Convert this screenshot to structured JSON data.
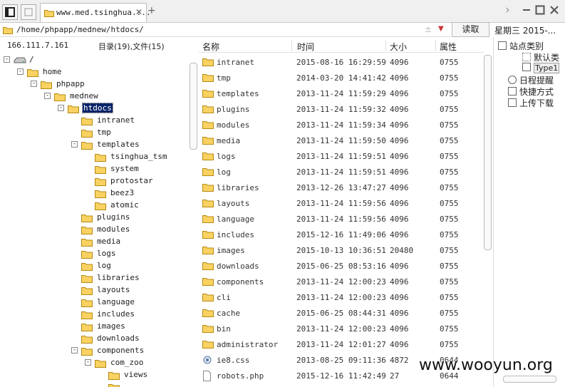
{
  "tab": {
    "title": "www.med.tsinghua...."
  },
  "address": {
    "path": "/home/phpapp/mednew/htdocs/",
    "read_button": "读取",
    "date": "星期三 2015-..."
  },
  "info": {
    "ip": "166.111.7.161",
    "counts": "目录(19),文件(15)"
  },
  "tree": [
    {
      "label": "/",
      "level": 0,
      "exp": "-",
      "drive": true
    },
    {
      "label": "home",
      "level": 1,
      "exp": "-"
    },
    {
      "label": "phpapp",
      "level": 2,
      "exp": "-"
    },
    {
      "label": "mednew",
      "level": 3,
      "exp": "-"
    },
    {
      "label": "htdocs",
      "level": 4,
      "exp": "-",
      "selected": true
    },
    {
      "label": "intranet",
      "level": 5,
      "exp": ""
    },
    {
      "label": "tmp",
      "level": 5,
      "exp": ""
    },
    {
      "label": "templates",
      "level": 5,
      "exp": "-"
    },
    {
      "label": "tsinghua_tsm",
      "level": 6,
      "exp": ""
    },
    {
      "label": "system",
      "level": 6,
      "exp": ""
    },
    {
      "label": "protostar",
      "level": 6,
      "exp": ""
    },
    {
      "label": "beez3",
      "level": 6,
      "exp": ""
    },
    {
      "label": "atomic",
      "level": 6,
      "exp": ""
    },
    {
      "label": "plugins",
      "level": 5,
      "exp": ""
    },
    {
      "label": "modules",
      "level": 5,
      "exp": ""
    },
    {
      "label": "media",
      "level": 5,
      "exp": ""
    },
    {
      "label": "logs",
      "level": 5,
      "exp": ""
    },
    {
      "label": "log",
      "level": 5,
      "exp": ""
    },
    {
      "label": "libraries",
      "level": 5,
      "exp": ""
    },
    {
      "label": "layouts",
      "level": 5,
      "exp": ""
    },
    {
      "label": "language",
      "level": 5,
      "exp": ""
    },
    {
      "label": "includes",
      "level": 5,
      "exp": ""
    },
    {
      "label": "images",
      "level": 5,
      "exp": ""
    },
    {
      "label": "downloads",
      "level": 5,
      "exp": ""
    },
    {
      "label": "components",
      "level": 5,
      "exp": "-"
    },
    {
      "label": "com_zoo",
      "level": 6,
      "exp": "-"
    },
    {
      "label": "views",
      "level": 7,
      "exp": ""
    },
    {
      "label": "",
      "level": 7,
      "exp": ""
    }
  ],
  "files": {
    "headers": {
      "name": "名称",
      "time": "时间",
      "size": "大小",
      "attr": "属性"
    },
    "rows": [
      {
        "name": "intranet",
        "time": "2015-08-16 16:29:59",
        "size": "4096",
        "attr": "0755",
        "type": "folder"
      },
      {
        "name": "tmp",
        "time": "2014-03-20 14:41:42",
        "size": "4096",
        "attr": "0755",
        "type": "folder"
      },
      {
        "name": "templates",
        "time": "2013-11-24 11:59:29",
        "size": "4096",
        "attr": "0755",
        "type": "folder"
      },
      {
        "name": "plugins",
        "time": "2013-11-24 11:59:32",
        "size": "4096",
        "attr": "0755",
        "type": "folder"
      },
      {
        "name": "modules",
        "time": "2013-11-24 11:59:34",
        "size": "4096",
        "attr": "0755",
        "type": "folder"
      },
      {
        "name": "media",
        "time": "2013-11-24 11:59:50",
        "size": "4096",
        "attr": "0755",
        "type": "folder"
      },
      {
        "name": "logs",
        "time": "2013-11-24 11:59:51",
        "size": "4096",
        "attr": "0755",
        "type": "folder"
      },
      {
        "name": "log",
        "time": "2013-11-24 11:59:51",
        "size": "4096",
        "attr": "0755",
        "type": "folder"
      },
      {
        "name": "libraries",
        "time": "2013-12-26 13:47:27",
        "size": "4096",
        "attr": "0755",
        "type": "folder"
      },
      {
        "name": "layouts",
        "time": "2013-11-24 11:59:56",
        "size": "4096",
        "attr": "0755",
        "type": "folder"
      },
      {
        "name": "language",
        "time": "2013-11-24 11:59:56",
        "size": "4096",
        "attr": "0755",
        "type": "folder"
      },
      {
        "name": "includes",
        "time": "2015-12-16 11:49:06",
        "size": "4096",
        "attr": "0755",
        "type": "folder"
      },
      {
        "name": "images",
        "time": "2015-10-13 10:36:51",
        "size": "20480",
        "attr": "0755",
        "type": "folder"
      },
      {
        "name": "downloads",
        "time": "2015-06-25 08:53:16",
        "size": "4096",
        "attr": "0755",
        "type": "folder"
      },
      {
        "name": "components",
        "time": "2013-11-24 12:00:23",
        "size": "4096",
        "attr": "0755",
        "type": "folder"
      },
      {
        "name": "cli",
        "time": "2013-11-24 12:00:23",
        "size": "4096",
        "attr": "0755",
        "type": "folder"
      },
      {
        "name": "cache",
        "time": "2015-06-25 08:44:31",
        "size": "4096",
        "attr": "0755",
        "type": "folder"
      },
      {
        "name": "bin",
        "time": "2013-11-24 12:00:23",
        "size": "4096",
        "attr": "0755",
        "type": "folder"
      },
      {
        "name": "administrator",
        "time": "2013-11-24 12:01:27",
        "size": "4096",
        "attr": "0755",
        "type": "folder"
      },
      {
        "name": "ie8.css",
        "time": "2013-08-25 09:11:36",
        "size": "4872",
        "attr": "0644",
        "type": "css"
      },
      {
        "name": "robots.php",
        "time": "2015-12-16 11:42:49",
        "size": "27",
        "attr": "0644",
        "type": "file"
      }
    ]
  },
  "right_panel": {
    "items": [
      {
        "label": "站点类别",
        "icon": "box"
      },
      {
        "label": "默认类",
        "icon": "dotted"
      },
      {
        "label": "Type1",
        "icon": "box",
        "highlight": true
      },
      {
        "label": "日程提醒",
        "icon": "clock"
      },
      {
        "label": "快捷方式",
        "icon": "doc"
      },
      {
        "label": "上传下载",
        "icon": "box"
      }
    ]
  },
  "watermark": "www.wooyun.org"
}
